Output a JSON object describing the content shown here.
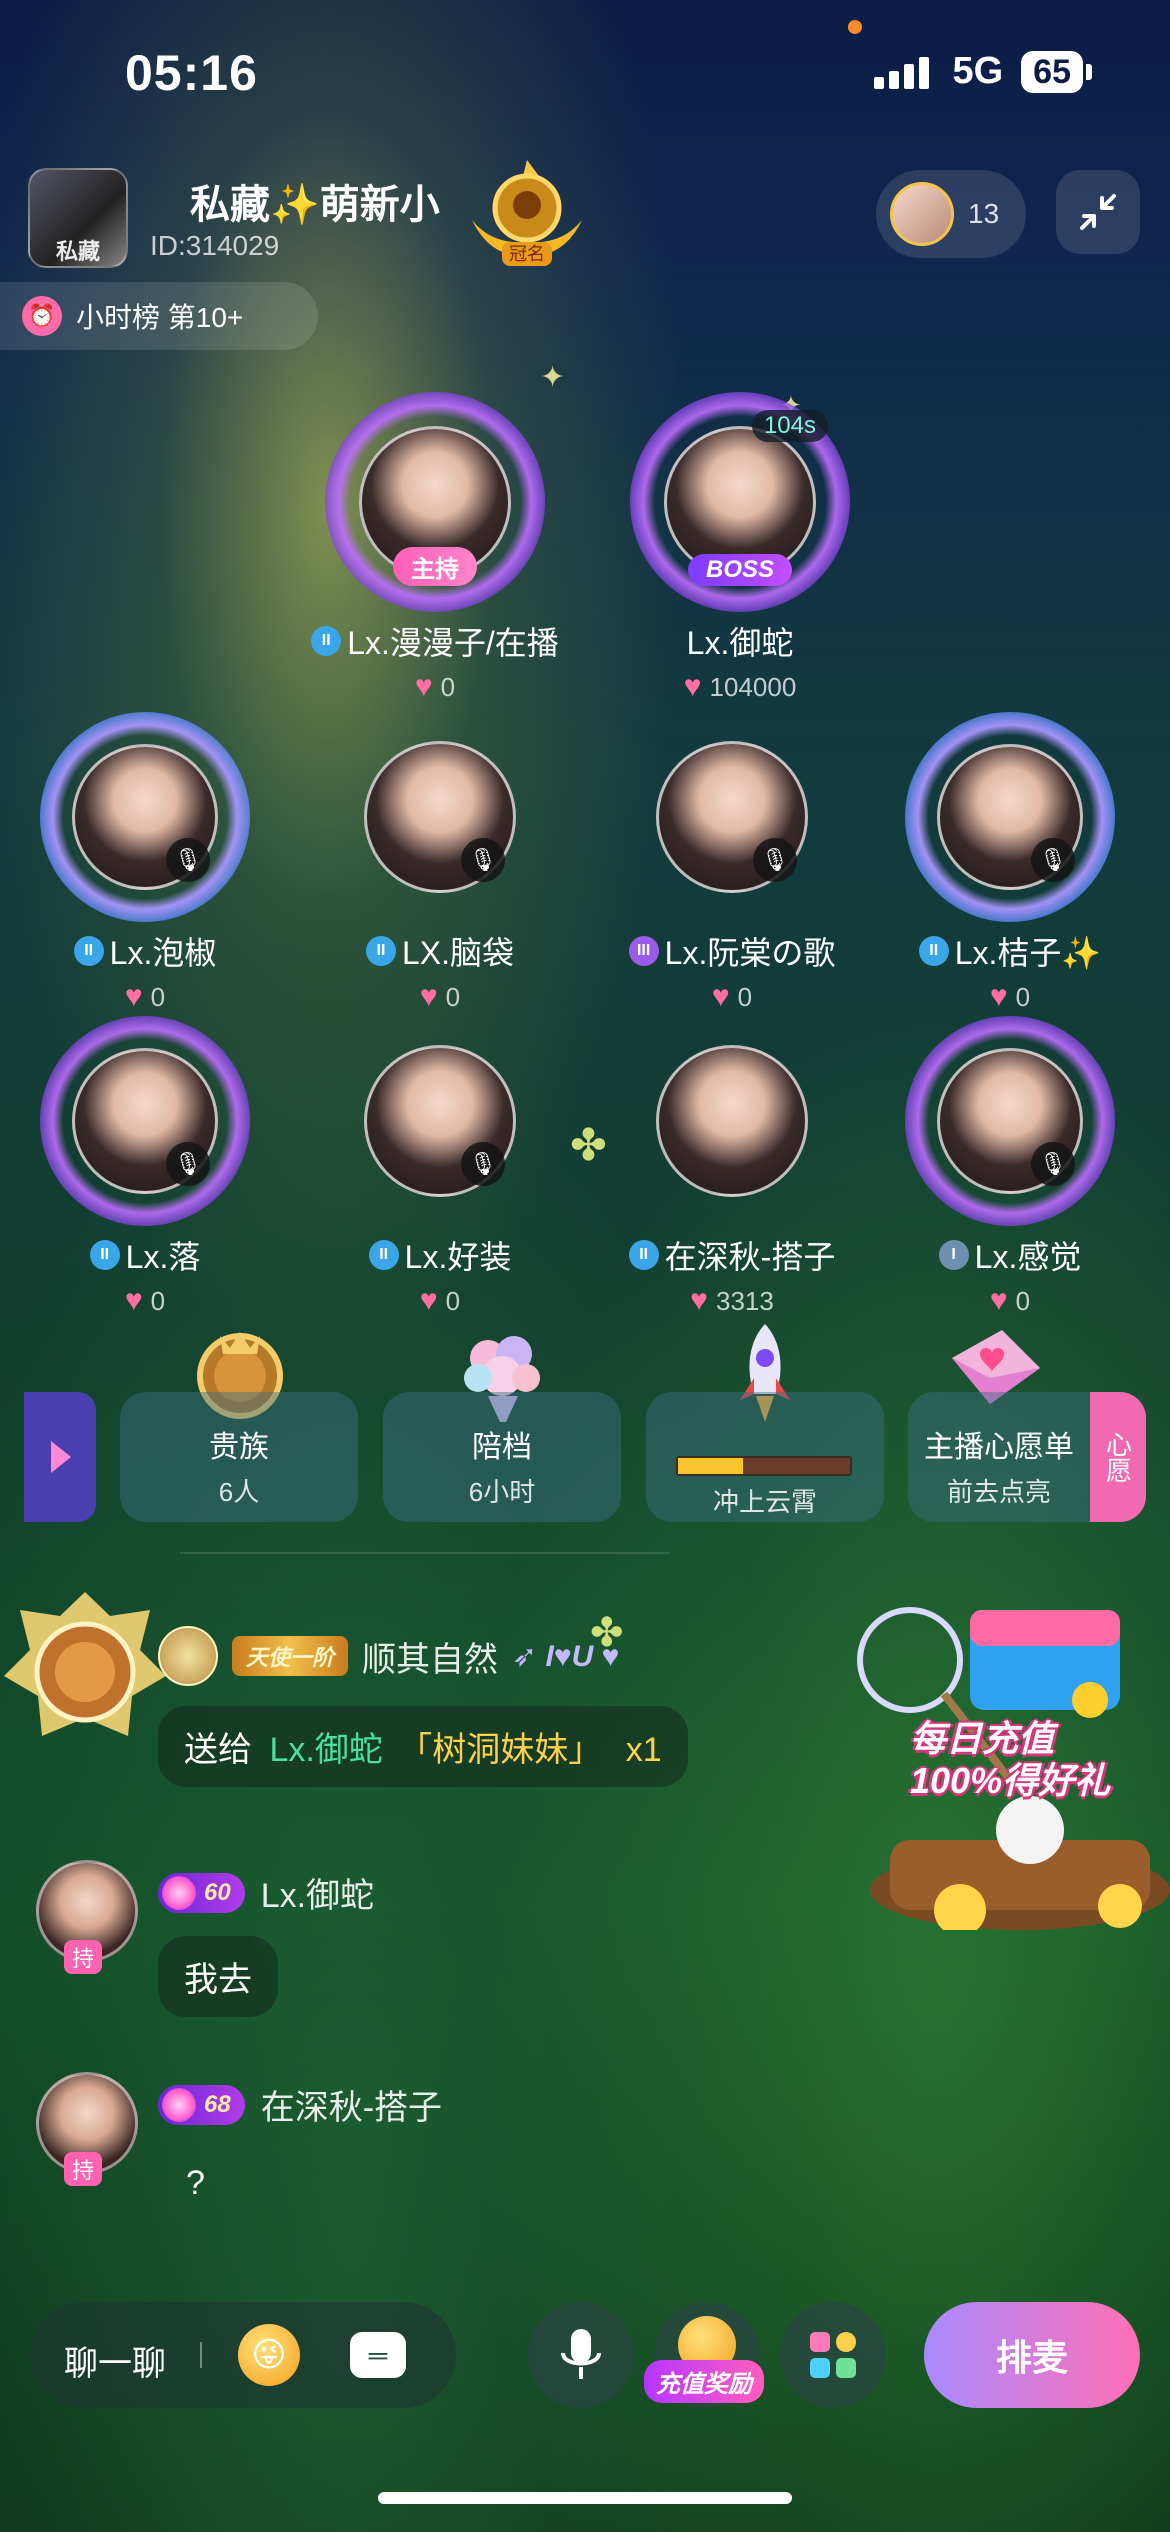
{
  "status_bar": {
    "time": "05:16",
    "network": "5G",
    "battery": "65"
  },
  "header": {
    "room_name": "私藏✨萌新小",
    "room_id": "ID:314029",
    "crown_label": "冠名",
    "viewer_count": "13",
    "hourly_rank": "小时榜 第10+"
  },
  "host_seats": [
    {
      "name": "Lx.漫漫子/在播",
      "score": "0",
      "tag": "主持",
      "level": "II"
    },
    {
      "name": "Lx.御蛇",
      "score": "104000",
      "tag": "BOSS",
      "timer": "104s"
    }
  ],
  "seats": [
    {
      "name": "Lx.泡椒",
      "score": "0",
      "level": "II"
    },
    {
      "name": "LX.脑袋",
      "score": "0",
      "level": "II"
    },
    {
      "name": "Lx.阮棠の歌",
      "score": "0",
      "level": "III"
    },
    {
      "name": "Lx.桔子✨",
      "score": "0",
      "level": "II"
    },
    {
      "name": "Lx.落",
      "score": "0",
      "level": "II"
    },
    {
      "name": "Lx.好装",
      "score": "0",
      "level": "II"
    },
    {
      "name": "在深秋-搭子",
      "score": "3313",
      "level": "II"
    },
    {
      "name": "Lx.感觉",
      "score": "0",
      "level": "I"
    }
  ],
  "features": [
    {
      "title": "贵族",
      "sub": "6人"
    },
    {
      "title": "陪档",
      "sub": "6小时"
    },
    {
      "title": "冲上云霄",
      "progress": 0.38
    },
    {
      "title": "主播心愿单",
      "sub": "前去点亮",
      "tab": "心愿"
    }
  ],
  "gift_message": {
    "sender": "顺其自然",
    "badge": "天使一阶",
    "prefix": "送给",
    "receiver": "Lx.御蛇",
    "gift": "「树洞妹妹」",
    "count": "x1"
  },
  "chat": [
    {
      "user": "Lx.御蛇",
      "level": "60",
      "text": "我去",
      "role": "持"
    },
    {
      "user": "在深秋-搭子",
      "level": "68",
      "text": "?",
      "role": "持"
    }
  ],
  "promo": {
    "line1": "每日充值",
    "line2": "100%得好礼"
  },
  "bottom_bar": {
    "chat_placeholder": "聊一聊",
    "recharge_label": "充值奖励",
    "queue_label": "排麦"
  },
  "colors": {
    "accent_pink": "#ff6fa3",
    "queue_gradient_start": "#a98aff",
    "queue_gradient_end": "#ff6fb5",
    "gift_receiver": "#4be0a0",
    "gift_name": "#ffd04a"
  }
}
